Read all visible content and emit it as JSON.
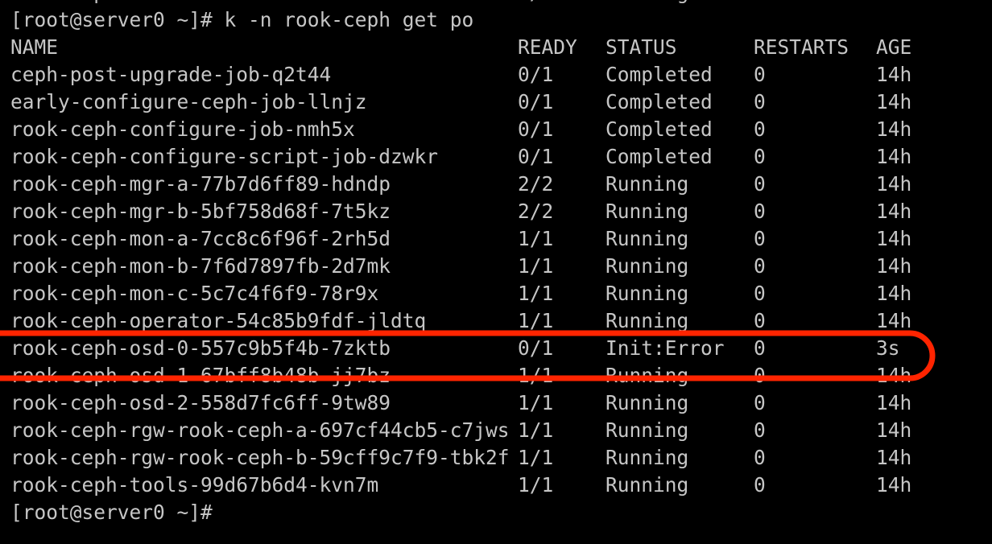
{
  "terminal": {
    "background_color": "#000000",
    "text_color": "#c6c6c6",
    "scrollback_line": {
      "name": "rook-ceph-tools-99d67b6d4-kvn7m",
      "ready": "1/1",
      "status": "Running",
      "restarts": "0",
      "age": "14h"
    },
    "command_line": "[root@server0 ~]# k -n rook-ceph get po",
    "trailing_prompt": "[root@server0 ~]#"
  },
  "table": {
    "headers": {
      "name": "NAME",
      "ready": "READY",
      "status": "STATUS",
      "restarts": "RESTARTS",
      "age": "AGE"
    },
    "rows": [
      {
        "name": "ceph-post-upgrade-job-q2t44",
        "ready": "0/1",
        "status": "Completed",
        "restarts": "0",
        "age": "14h"
      },
      {
        "name": "early-configure-ceph-job-llnjz",
        "ready": "0/1",
        "status": "Completed",
        "restarts": "0",
        "age": "14h"
      },
      {
        "name": "rook-ceph-configure-job-nmh5x",
        "ready": "0/1",
        "status": "Completed",
        "restarts": "0",
        "age": "14h"
      },
      {
        "name": "rook-ceph-configure-script-job-dzwkr",
        "ready": "0/1",
        "status": "Completed",
        "restarts": "0",
        "age": "14h"
      },
      {
        "name": "rook-ceph-mgr-a-77b7d6ff89-hdndp",
        "ready": "2/2",
        "status": "Running",
        "restarts": "0",
        "age": "14h"
      },
      {
        "name": "rook-ceph-mgr-b-5bf758d68f-7t5kz",
        "ready": "2/2",
        "status": "Running",
        "restarts": "0",
        "age": "14h"
      },
      {
        "name": "rook-ceph-mon-a-7cc8c6f96f-2rh5d",
        "ready": "1/1",
        "status": "Running",
        "restarts": "0",
        "age": "14h"
      },
      {
        "name": "rook-ceph-mon-b-7f6d7897fb-2d7mk",
        "ready": "1/1",
        "status": "Running",
        "restarts": "0",
        "age": "14h"
      },
      {
        "name": "rook-ceph-mon-c-5c7c4f6f9-78r9x",
        "ready": "1/1",
        "status": "Running",
        "restarts": "0",
        "age": "14h"
      },
      {
        "name": "rook-ceph-operator-54c85b9fdf-jldtq",
        "ready": "1/1",
        "status": "Running",
        "restarts": "0",
        "age": "14h"
      },
      {
        "name": "rook-ceph-osd-0-557c9b5f4b-7zktb",
        "ready": "0/1",
        "status": "Init:Error",
        "restarts": "0",
        "age": "3s"
      },
      {
        "name": "rook-ceph-osd-1-67bff8b48b-jj7bz",
        "ready": "1/1",
        "status": "Running",
        "restarts": "0",
        "age": "14h"
      },
      {
        "name": "rook-ceph-osd-2-558d7fc6ff-9tw89",
        "ready": "1/1",
        "status": "Running",
        "restarts": "0",
        "age": "14h"
      },
      {
        "name": "rook-ceph-rgw-rook-ceph-a-697cf44cb5-c7jws",
        "ready": "1/1",
        "status": "Running",
        "restarts": "0",
        "age": "14h"
      },
      {
        "name": "rook-ceph-rgw-rook-ceph-b-59cff9c7f9-tbk2f",
        "ready": "1/1",
        "status": "Running",
        "restarts": "0",
        "age": "14h"
      },
      {
        "name": "rook-ceph-tools-99d67b6d4-kvn7m",
        "ready": "1/1",
        "status": "Running",
        "restarts": "0",
        "age": "14h"
      }
    ]
  },
  "annotation": {
    "color": "#ff2400",
    "shape": "ellipse",
    "highlighted_row_index": 10,
    "highlighted_pod": "rook-ceph-osd-0-557c9b5f4b-7zktb"
  }
}
